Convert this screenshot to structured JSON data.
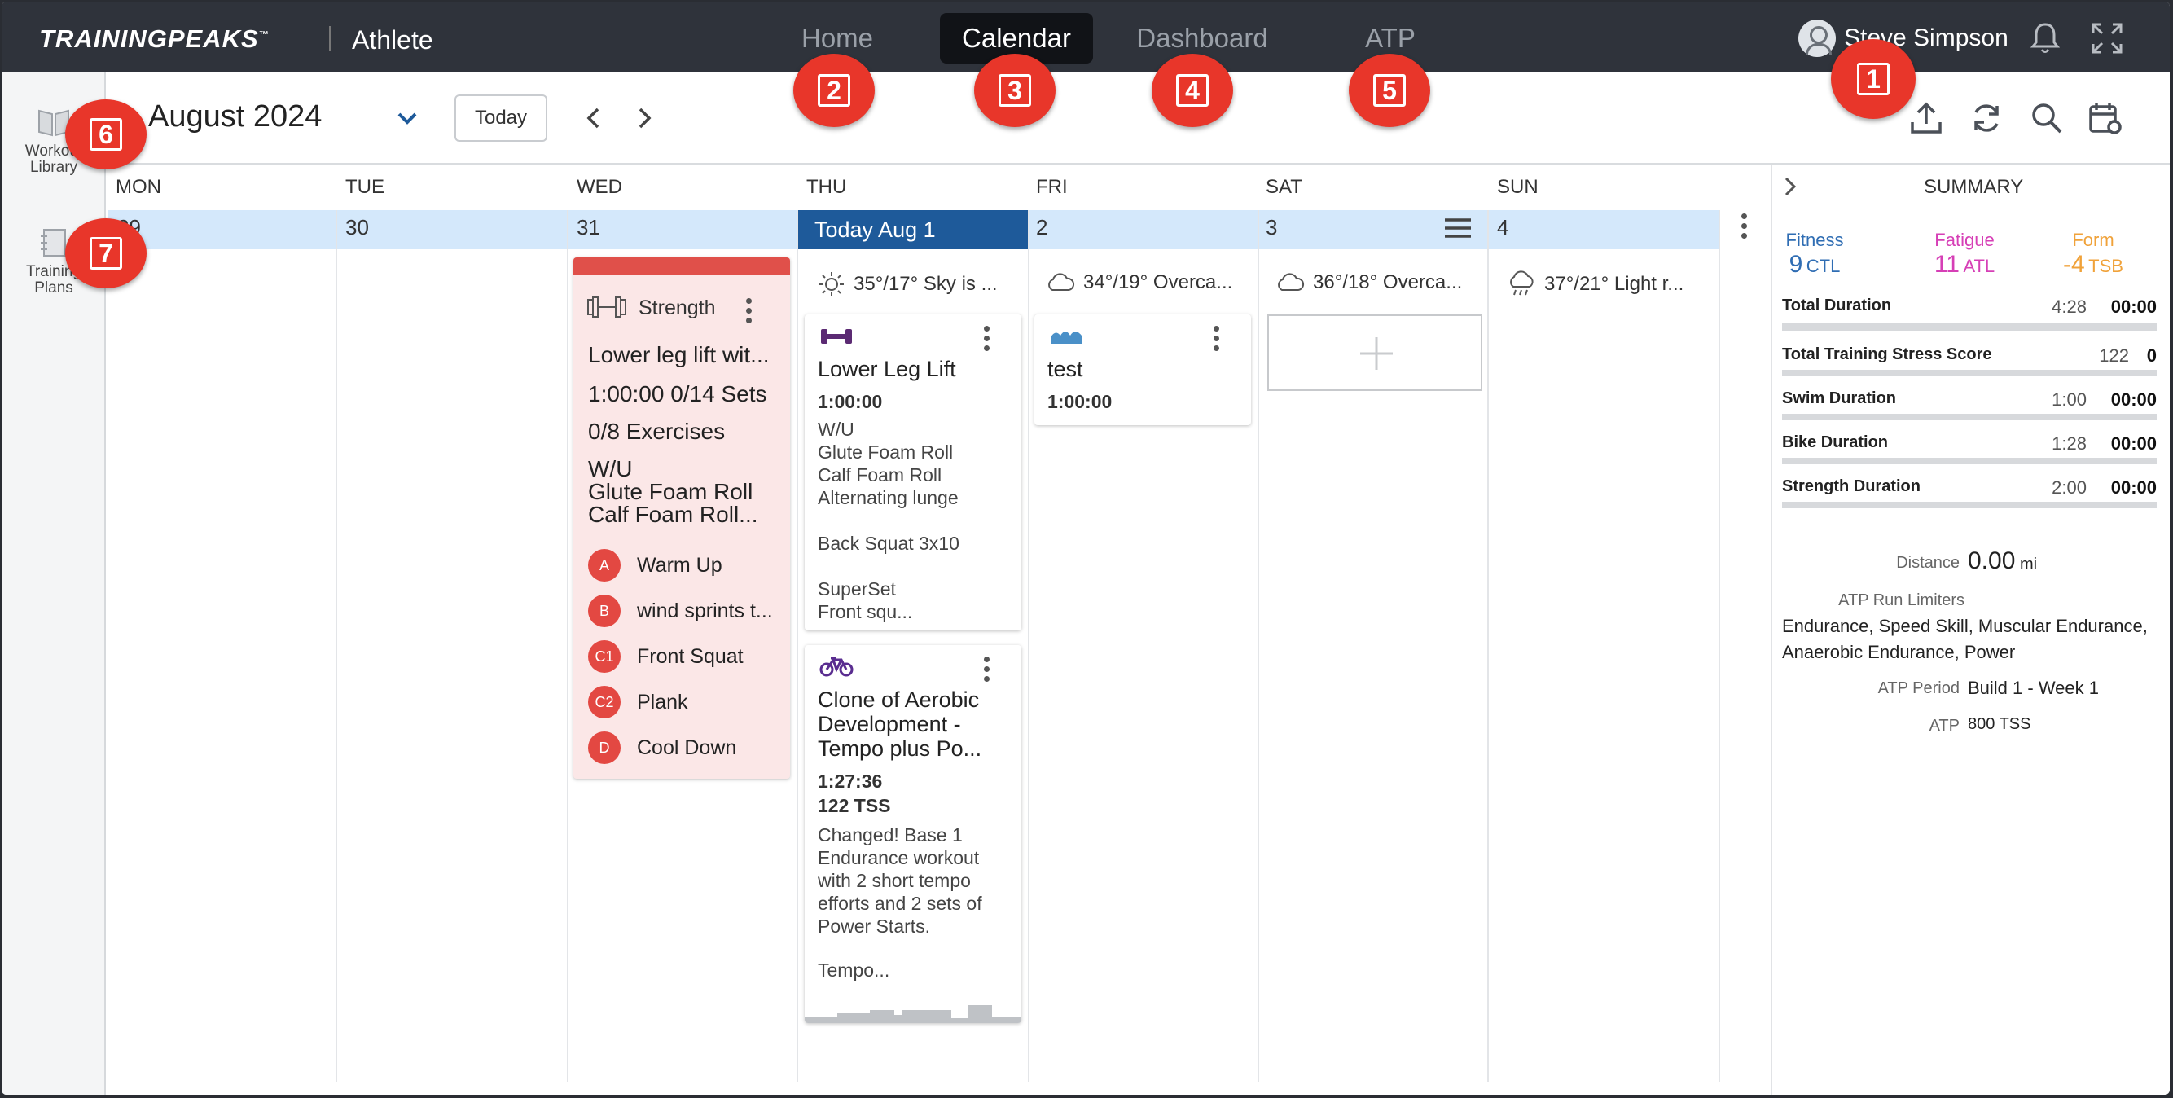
{
  "header": {
    "logo": "TRAININGPEAKS",
    "logo_tm": "™",
    "app_name": "Athlete",
    "nav": [
      "Home",
      "Calendar",
      "Dashboard",
      "ATP"
    ],
    "active_nav": "Calendar",
    "user_name": "Steve Simpson"
  },
  "badges": [
    "1",
    "2",
    "3",
    "4",
    "5",
    "6",
    "7"
  ],
  "rail": {
    "workout_library_line1": "Workout",
    "workout_library_line2": "Library",
    "training_plans_line1": "Training",
    "training_plans_line2": "Plans"
  },
  "toolbar": {
    "month": "August 2024",
    "today_label": "Today"
  },
  "days": [
    "MON",
    "TUE",
    "WED",
    "THU",
    "FRI",
    "SAT",
    "SUN"
  ],
  "dates": [
    "29",
    "30",
    "31",
    "Today Aug 1",
    "2",
    "3",
    "4"
  ],
  "weather": {
    "thu": "35°/17° Sky is ...",
    "fri": "34°/19° Overca...",
    "sat": "36°/18° Overca...",
    "sun": "37°/21° Light r..."
  },
  "strength_card": {
    "type": "Strength",
    "title": "Lower leg lift wit...",
    "duration_sets": "1:00:00 0/14 Sets",
    "exercises": "0/8 Exercises",
    "desc1": "W/U",
    "desc2": "Glute Foam Roll",
    "desc3": "Calf Foam Roll...",
    "steps": [
      {
        "key": "A",
        "label": "Warm Up"
      },
      {
        "key": "B",
        "label": "wind sprints t..."
      },
      {
        "key": "C1",
        "label": "Front Squat"
      },
      {
        "key": "C2",
        "label": "Plank"
      },
      {
        "key": "D",
        "label": "Cool Down"
      }
    ]
  },
  "lower_leg_card": {
    "title": "Lower Leg Lift",
    "duration": "1:00:00",
    "lines": [
      "W/U",
      "Glute Foam Roll",
      "Calf Foam Roll",
      "Alternating lunge",
      "",
      "Back Squat 3x10",
      "",
      "SuperSet",
      "Front squ..."
    ]
  },
  "bike_card": {
    "title1": "Clone of Aerobic",
    "title2": "Development -",
    "title3": "Tempo plus Po...",
    "duration": "1:27:36",
    "tss": "122 TSS",
    "lines": [
      "Changed! Base 1",
      "Endurance workout",
      "with 2 short tempo",
      "efforts and 2 sets of",
      "Power Starts.",
      "",
      "Tempo..."
    ]
  },
  "swim_card": {
    "title": "test",
    "duration": "1:00:00"
  },
  "summary": {
    "title": "SUMMARY",
    "fitness": {
      "label": "Fitness",
      "value": "9",
      "unit": "CTL"
    },
    "fatigue": {
      "label": "Fatigue",
      "value": "11",
      "unit": "ATL"
    },
    "form": {
      "label": "Form",
      "value": "-4",
      "unit": "TSB"
    },
    "rows": [
      {
        "name": "Total Duration",
        "planned": "4:28",
        "actual": "00:00"
      },
      {
        "name": "Total Training Stress Score",
        "planned": "122",
        "actual": "0"
      },
      {
        "name": "Swim Duration",
        "planned": "1:00",
        "actual": "00:00"
      },
      {
        "name": "Bike Duration",
        "planned": "1:28",
        "actual": "00:00"
      },
      {
        "name": "Strength Duration",
        "planned": "2:00",
        "actual": "00:00"
      }
    ],
    "distance_label": "Distance",
    "distance_value": "0.00",
    "distance_unit": "mi",
    "limiters_label": "ATP Run Limiters",
    "limiters_line1": "Endurance, Speed Skill, Muscular Endurance,",
    "limiters_line2": "Anaerobic Endurance, Power",
    "atp_period_label": "ATP Period",
    "atp_period_value": "Build 1 - Week 1",
    "atp_label": "ATP",
    "atp_value": "800 TSS"
  },
  "colors": {
    "accent_red": "#e8362a",
    "today_blue": "#1e5a9a",
    "fitness": "#2f6db3",
    "fatigue": "#d63fb6",
    "form": "#f0a23a",
    "strength_purple": "#5b2a73",
    "swim_blue": "#4a90c8",
    "bike_purple": "#5a2d90"
  }
}
